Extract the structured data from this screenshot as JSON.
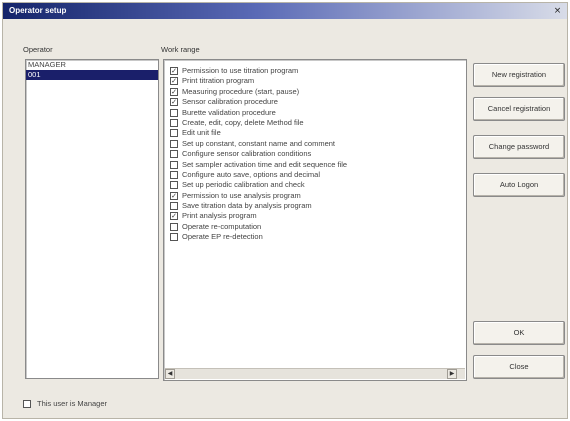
{
  "window": {
    "title": "Operator setup",
    "close_glyph": "×"
  },
  "operator_panel": {
    "label": "Operator",
    "items": [
      {
        "label": "MANAGER",
        "selected": false
      },
      {
        "label": "001",
        "selected": true
      }
    ]
  },
  "work_panel": {
    "label": "Work range",
    "items": [
      {
        "label": "Permission to use titration program",
        "checked": true
      },
      {
        "label": "Print titration program",
        "checked": true
      },
      {
        "label": "Measuring procedure (start, pause)",
        "checked": true
      },
      {
        "label": "Sensor calibration procedure",
        "checked": true
      },
      {
        "label": "Burette validation procedure",
        "checked": false
      },
      {
        "label": "Create, edit, copy, delete Method file",
        "checked": false
      },
      {
        "label": "Edit unit file",
        "checked": false
      },
      {
        "label": "Set up constant, constant name and comment",
        "checked": false
      },
      {
        "label": "Configure sensor calibration conditions",
        "checked": false
      },
      {
        "label": "Set sampler activation time and edit sequence file",
        "checked": false
      },
      {
        "label": "Configure auto save, options and decimal",
        "checked": false
      },
      {
        "label": "Set up periodic calibration and check",
        "checked": false
      },
      {
        "label": "Permission to use analysis program",
        "checked": true
      },
      {
        "label": "Save titration data by analysis program",
        "checked": false
      },
      {
        "label": "Print analysis program",
        "checked": true
      },
      {
        "label": "Operate re-computation",
        "checked": false
      },
      {
        "label": "Operate EP re-detection",
        "checked": false
      }
    ],
    "scroll_left_glyph": "◀",
    "scroll_right_glyph": "▶"
  },
  "buttons": {
    "new_registration": "New registration",
    "cancel_registration": "Cancel registration",
    "change_password": "Change password",
    "auto_logon": "Auto Logon",
    "ok": "OK",
    "close": "Close"
  },
  "manager_checkbox": {
    "label": "This user is Manager",
    "checked": false
  }
}
